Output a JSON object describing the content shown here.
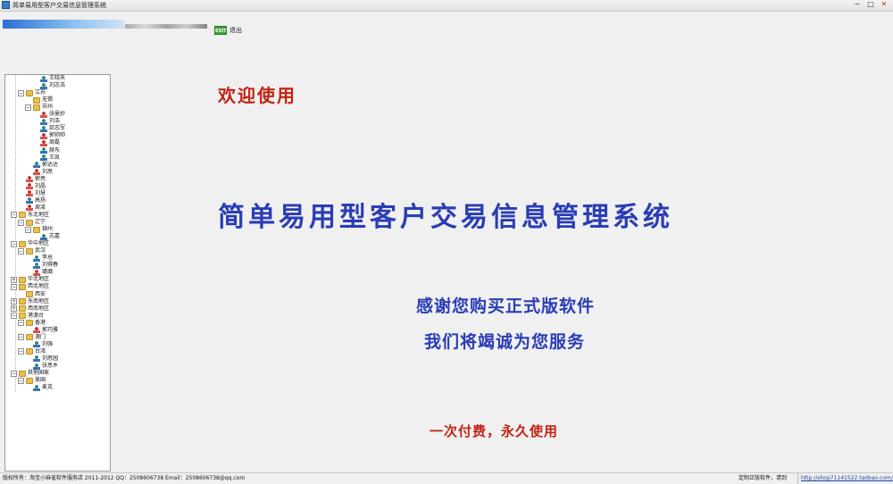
{
  "window": {
    "title": "简单易用型客户交易信息管理系统",
    "controls": {
      "minimize": "─",
      "maximize": "□",
      "close": "✕"
    }
  },
  "toolbar": {
    "exit_icon_text": "EXIT",
    "exit_label": "退出"
  },
  "tree": {
    "nodes": [
      {
        "label": "王晓天",
        "depth": 3,
        "icon": "male",
        "expander": ""
      },
      {
        "label": "刘志浩",
        "depth": 3,
        "icon": "male",
        "expander": ""
      },
      {
        "label": "江苏",
        "depth": 1,
        "icon": "folder",
        "expander": "−"
      },
      {
        "label": "无锡",
        "depth": 2,
        "icon": "folder",
        "expander": ""
      },
      {
        "label": "苏州",
        "depth": 2,
        "icon": "folder",
        "expander": "−"
      },
      {
        "label": "张曼妙",
        "depth": 3,
        "icon": "female",
        "expander": ""
      },
      {
        "label": "刘浩",
        "depth": 3,
        "icon": "male",
        "expander": ""
      },
      {
        "label": "邱志军",
        "depth": 3,
        "icon": "male",
        "expander": ""
      },
      {
        "label": "郭帅帅",
        "depth": 3,
        "icon": "female",
        "expander": ""
      },
      {
        "label": "周磊",
        "depth": 3,
        "icon": "female",
        "expander": ""
      },
      {
        "label": "赫东",
        "depth": 3,
        "icon": "male",
        "expander": ""
      },
      {
        "label": "王凯",
        "depth": 3,
        "icon": "male",
        "expander": ""
      },
      {
        "label": "郭达达",
        "depth": 2,
        "icon": "male",
        "expander": ""
      },
      {
        "label": "刘思",
        "depth": 2,
        "icon": "female",
        "expander": ""
      },
      {
        "label": "郭亮",
        "depth": 1,
        "icon": "female",
        "expander": ""
      },
      {
        "label": "刘晶",
        "depth": 1,
        "icon": "female",
        "expander": ""
      },
      {
        "label": "刘慧",
        "depth": 1,
        "icon": "female",
        "expander": ""
      },
      {
        "label": "高扬",
        "depth": 1,
        "icon": "male",
        "expander": ""
      },
      {
        "label": "周凌",
        "depth": 1,
        "icon": "female",
        "expander": ""
      },
      {
        "label": "东北地区",
        "depth": 0,
        "icon": "folder",
        "expander": "−"
      },
      {
        "label": "辽宁",
        "depth": 1,
        "icon": "folder",
        "expander": "−"
      },
      {
        "label": "锦州",
        "depth": 2,
        "icon": "folder",
        "expander": "−"
      },
      {
        "label": "志嘉",
        "depth": 3,
        "icon": "male",
        "expander": ""
      },
      {
        "label": "华中地区",
        "depth": 0,
        "icon": "folder",
        "expander": "−"
      },
      {
        "label": "武汉",
        "depth": 1,
        "icon": "folder",
        "expander": "−"
      },
      {
        "label": "李总",
        "depth": 2,
        "icon": "male",
        "expander": ""
      },
      {
        "label": "刘得春",
        "depth": 2,
        "icon": "male",
        "expander": ""
      },
      {
        "label": "璐璐",
        "depth": 2,
        "icon": "female",
        "expander": ""
      },
      {
        "label": "华北地区",
        "depth": 0,
        "icon": "folder",
        "expander": "+"
      },
      {
        "label": "西北地区",
        "depth": 0,
        "icon": "folder",
        "expander": "−"
      },
      {
        "label": "西安",
        "depth": 1,
        "icon": "folder",
        "expander": ""
      },
      {
        "label": "东南地区",
        "depth": 0,
        "icon": "folder",
        "expander": "+"
      },
      {
        "label": "西南地区",
        "depth": 0,
        "icon": "folder",
        "expander": "+"
      },
      {
        "label": "港澳台",
        "depth": 0,
        "icon": "folder",
        "expander": "−"
      },
      {
        "label": "香港",
        "depth": 1,
        "icon": "folder",
        "expander": "−"
      },
      {
        "label": "郭巧雅",
        "depth": 2,
        "icon": "female",
        "expander": ""
      },
      {
        "label": "澳门",
        "depth": 1,
        "icon": "folder",
        "expander": "−"
      },
      {
        "label": "刘强",
        "depth": 2,
        "icon": "male",
        "expander": ""
      },
      {
        "label": "台湾",
        "depth": 1,
        "icon": "folder",
        "expander": "−"
      },
      {
        "label": "刘思园",
        "depth": 2,
        "icon": "male",
        "expander": ""
      },
      {
        "label": "张思乡",
        "depth": 2,
        "icon": "male",
        "expander": ""
      },
      {
        "label": "其他国家",
        "depth": 0,
        "icon": "folder",
        "expander": "−"
      },
      {
        "label": "美国",
        "depth": 1,
        "icon": "folder",
        "expander": "−"
      },
      {
        "label": "麦克",
        "depth": 2,
        "icon": "male",
        "expander": ""
      }
    ]
  },
  "main": {
    "welcome": "欢迎使用",
    "system_title": "简单易用型客户交易信息管理系统",
    "thanks": "感谢您购买正式版软件",
    "service": "我们将竭诚为您服务",
    "slogan": "一次付费，永久使用"
  },
  "statusbar": {
    "copyright": "版权所有：淘宝小麻雀软件服务店 2011-2012    QQ：2508606738    Email：2508606738@qq.com",
    "custom": "定制正版软件，请到",
    "link": "http://shop71141522.taobao.com/"
  },
  "colors": {
    "red_text": "#c22314",
    "blue_text": "#2a3db5",
    "background": "#f0f0f0"
  }
}
